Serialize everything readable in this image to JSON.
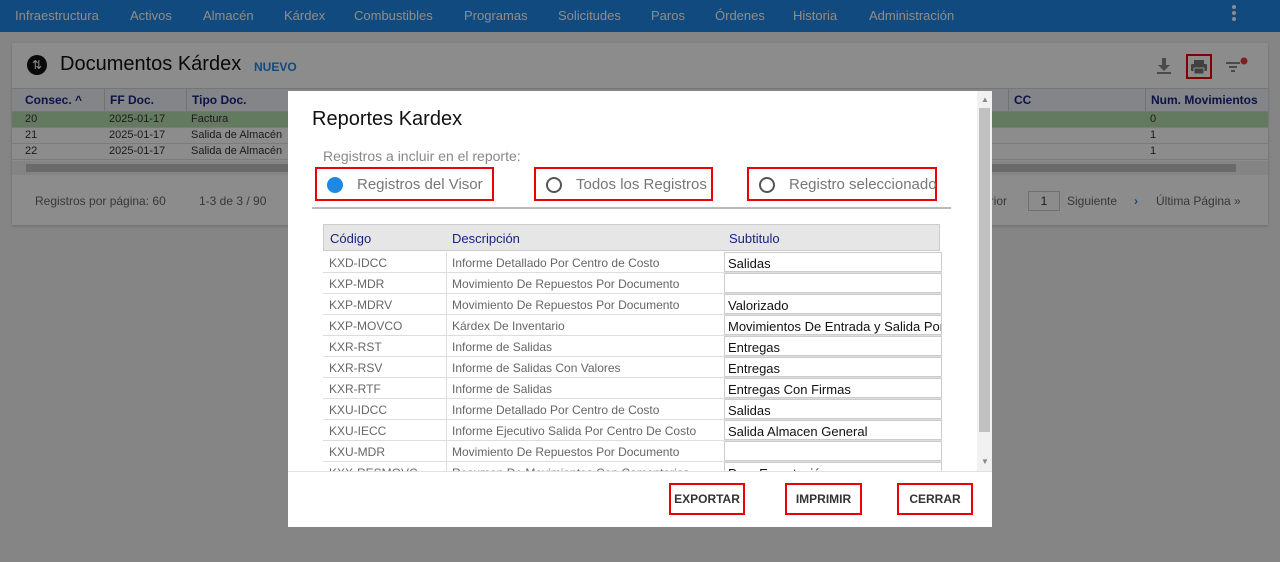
{
  "nav": {
    "items": [
      "Infraestructura",
      "Activos",
      "Almacén",
      "Kárdex",
      "Combustibles",
      "Programas",
      "Solicitudes",
      "Paros",
      "Órdenes",
      "Historia",
      "Administración"
    ]
  },
  "page": {
    "title": "Documentos Kárdex",
    "new_label": "NUEVO"
  },
  "grid": {
    "columns": [
      "Consec.",
      "FF Doc.",
      "Tipo Doc.",
      "",
      "",
      "",
      "",
      "",
      "",
      "CC",
      "Num. Movimientos"
    ],
    "rows": [
      {
        "consec": "20",
        "fecha": "2025-01-17",
        "tipo": "Factura",
        "num": "0"
      },
      {
        "consec": "21",
        "fecha": "2025-01-17",
        "tipo": "Salida de Almacén",
        "num": "1"
      },
      {
        "consec": "22",
        "fecha": "2025-01-17",
        "tipo": "Salida de Almacén",
        "num": "1"
      }
    ]
  },
  "pager": {
    "per_page": "Registros por página: 60",
    "range": "1-3 de 3 / 90",
    "prev": "erior",
    "page": "1",
    "next": "Siguiente",
    "last": "Última Página »"
  },
  "modal": {
    "title": "Reportes Kardex",
    "subtitle": "Registros a incluir en el reporte:",
    "options": [
      "Registros del Visor",
      "Todos los Registros",
      "Registro seleccionado"
    ],
    "selected_option": 0,
    "table": {
      "headers": [
        "Código",
        "Descripción",
        "Subtitulo"
      ],
      "rows": [
        {
          "code": "KXD-IDCC",
          "desc": "Informe Detallado Por Centro de Costo",
          "sub": "Salidas"
        },
        {
          "code": "KXP-MDR",
          "desc": "Movimiento De Repuestos Por Documento",
          "sub": ""
        },
        {
          "code": "KXP-MDRV",
          "desc": "Movimiento De Repuestos Por Documento",
          "sub": "Valorizado"
        },
        {
          "code": "KXP-MOVCO",
          "desc": "Kárdex De Inventario",
          "sub": "Movimientos De Entrada y Salida Por"
        },
        {
          "code": "KXR-RST",
          "desc": "Informe de Salidas",
          "sub": "Entregas"
        },
        {
          "code": "KXR-RSV",
          "desc": "Informe de Salidas Con Valores",
          "sub": "Entregas"
        },
        {
          "code": "KXR-RTF",
          "desc": "Informe de Salidas",
          "sub": "Entregas Con Firmas"
        },
        {
          "code": "KXU-IDCC",
          "desc": "Informe Detallado Por Centro de Costo",
          "sub": "Salidas"
        },
        {
          "code": "KXU-IECC",
          "desc": "Informe Ejecutivo Salida Por Centro De Costo",
          "sub": "Salida Almacen General"
        },
        {
          "code": "KXU-MDR",
          "desc": "Movimiento De Repuestos Por Documento",
          "sub": ""
        },
        {
          "code": "KXX-RESMOVC",
          "desc": "Resumen De Movimientos Con Comentarios",
          "sub": "Para Exportación"
        }
      ]
    },
    "buttons": {
      "export": "EXPORTAR",
      "print": "IMPRIMIR",
      "close": "CERRAR"
    }
  },
  "colors": {
    "primary": "#1e88e5",
    "highlight": "#e00000",
    "selected_row": "#b7dfb0"
  }
}
